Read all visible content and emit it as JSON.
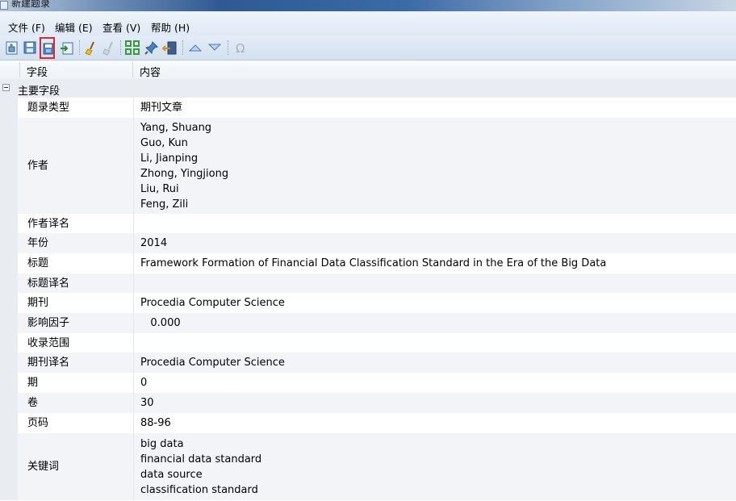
{
  "window": {
    "title": "新建题录"
  },
  "menu": {
    "file": "文件 (F)",
    "edit": "编辑 (E)",
    "view": "查看 (V)",
    "help": "帮助 (H)"
  },
  "toolbar": {
    "icons": [
      "new-record-icon",
      "save-icon",
      "save-copy-icon",
      "export-icon",
      "clean-brush-icon",
      "clean-disabled-icon",
      "grid-icon",
      "pin-icon",
      "close-record-icon",
      "move-up-icon",
      "move-down-icon",
      "omega-icon"
    ],
    "highlight_color": "#e2262b"
  },
  "table": {
    "headers": {
      "field": "字段",
      "content": "内容"
    },
    "group": "主要字段",
    "rows": [
      {
        "field": "题录类型",
        "content": [
          "期刊文章"
        ]
      },
      {
        "field": "作者",
        "content": [
          "Yang, Shuang",
          "Guo, Kun",
          "Li, Jianping",
          "Zhong, Yingjiong",
          "Liu, Rui",
          "Feng, Zili"
        ]
      },
      {
        "field": "作者译名",
        "content": []
      },
      {
        "field": "年份",
        "content": [
          "2014"
        ]
      },
      {
        "field": "标题",
        "content": [
          "Framework Formation of Financial Data Classification Standard in the Era of the Big Data"
        ]
      },
      {
        "field": "标题译名",
        "content": []
      },
      {
        "field": "期刊",
        "content": [
          "Procedia Computer Science"
        ]
      },
      {
        "field": "影响因子",
        "content": [
          "   0.000"
        ]
      },
      {
        "field": "收录范围",
        "content": []
      },
      {
        "field": "期刊译名",
        "content": [
          "Procedia Computer Science"
        ]
      },
      {
        "field": "期",
        "content": [
          "0"
        ]
      },
      {
        "field": "卷",
        "content": [
          "30"
        ]
      },
      {
        "field": "页码",
        "content": [
          "88-96"
        ]
      },
      {
        "field": "关键词",
        "content": [
          "big data",
          "financial data standard",
          "data source",
          "classification standard"
        ]
      }
    ]
  }
}
